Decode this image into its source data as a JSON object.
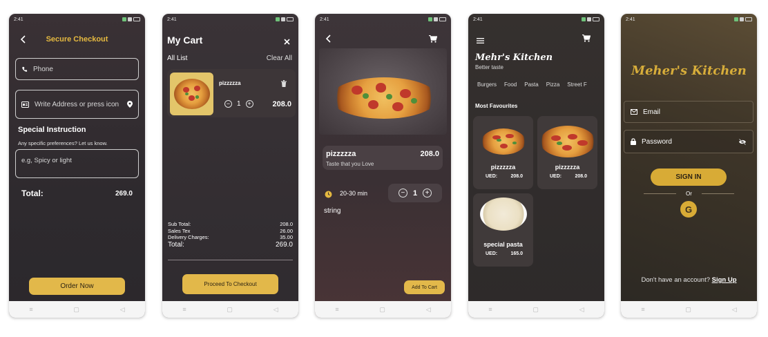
{
  "colors": {
    "gold": "#e5b940",
    "button": "#e2b84a",
    "dark": "#2f2b2f"
  },
  "status_time": "2:41",
  "checkout": {
    "title": "Secure Checkout",
    "phone_placeholder": "Phone",
    "address_placeholder": "Write Address or press icon",
    "special_title": "Special Instruction",
    "special_hint": "Any specific preferences? Let us know.",
    "instruction_placeholder": "e.g, Spicy or light",
    "total_label": "Total:",
    "total_value": "269.0",
    "order_button": "Order Now"
  },
  "cart": {
    "title": "My Cart",
    "all_list": "All List",
    "clear_all": "Clear All",
    "item": {
      "name": "pizzzzza",
      "qty": "1",
      "price": "208.0"
    },
    "summary": [
      {
        "label": "Sub Total:",
        "value": "208.0"
      },
      {
        "label": "Sales Tex",
        "value": "26.00"
      },
      {
        "label": "Delivery Charges:",
        "value": "35.00"
      }
    ],
    "total_label": "Total:",
    "total_value": "269.0",
    "checkout_button": "Proceed To Checkout"
  },
  "detail": {
    "name": "pizzzzza",
    "price": "208.0",
    "tagline": "Taste that you Love",
    "time": "20-30 min",
    "qty": "1",
    "description": "string",
    "add_button": "Add To Cart"
  },
  "home": {
    "brand": "Mehr's Kitchen",
    "subtitle": "Better taste",
    "categories": [
      "Burgers",
      "Food",
      "Pasta",
      "Pizza",
      "Street F"
    ],
    "section_title": "Most Favourites",
    "items": [
      {
        "name": "pizzzzza",
        "currency": "UED:",
        "price": "208.0"
      },
      {
        "name": "pizzzzza",
        "currency": "UED:",
        "price": "208.0"
      },
      {
        "name": "special pasta",
        "currency": "UED:",
        "price": "165.0"
      }
    ]
  },
  "login": {
    "brand": "Meher's Kitchen",
    "email_placeholder": "Email",
    "password_placeholder": "Password",
    "signin_button": "SIGN IN",
    "or_text": "Or",
    "google_letter": "G",
    "no_account": "Don't have an account?",
    "signup_link": "Sign Up"
  },
  "nav": {
    "menu": "≡",
    "home": "▢",
    "back": "◁"
  },
  "icons": {
    "back": "back-arrow-icon",
    "close": "close-icon",
    "cart": "cart-icon",
    "menu": "menu-icon",
    "phone": "phone-icon",
    "card": "address-card-icon",
    "location": "location-pin-icon",
    "delete": "trash-icon",
    "minus": "minus-icon",
    "plus": "plus-icon",
    "clock": "clock-icon",
    "mail": "mail-icon",
    "lock": "lock-icon",
    "eye": "eye-off-icon",
    "google": "google-icon"
  }
}
